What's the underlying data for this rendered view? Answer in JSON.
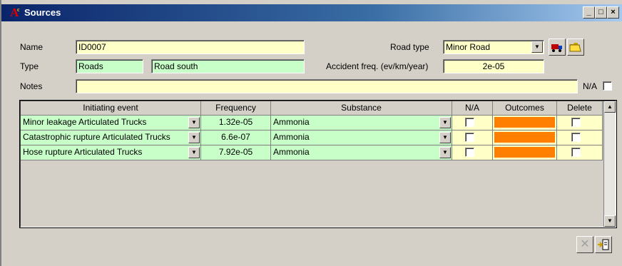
{
  "window": {
    "title": "Sources"
  },
  "form": {
    "name_label": "Name",
    "name_value": "ID0007",
    "type_label": "Type",
    "type_value": "Roads",
    "type_detail": "Road south",
    "notes_label": "Notes",
    "notes_value": "",
    "road_type_label": "Road type",
    "road_type_value": "Minor Road",
    "accident_freq_label": "Accident freq. (ev/km/year)",
    "accident_freq_value": "2e-05",
    "na_label": "N/A"
  },
  "grid": {
    "columns": [
      "Initiating event",
      "Frequency",
      "Substance",
      "N/A",
      "Outcomes",
      "Delete"
    ],
    "rows": [
      {
        "event": "Minor leakage Articulated Trucks",
        "frequency": "1.32e-05",
        "substance": "Ammonia"
      },
      {
        "event": "Catastrophic rupture Articulated Trucks",
        "frequency": "6.6e-07",
        "substance": "Ammonia"
      },
      {
        "event": "Hose rupture Articulated Trucks",
        "frequency": "7.92e-05",
        "substance": "Ammonia"
      }
    ]
  },
  "colors": {
    "field_yellow": "#ffffc8",
    "field_green": "#c8ffc8",
    "outcomes_orange": "#ff8000",
    "title_bar": "#0a246a"
  },
  "icons": {
    "app": "application-logo-icon",
    "truck": "truck-icon",
    "open_folder": "open-folder-icon",
    "delete": "delete-x-icon",
    "exit": "exit-icon"
  }
}
